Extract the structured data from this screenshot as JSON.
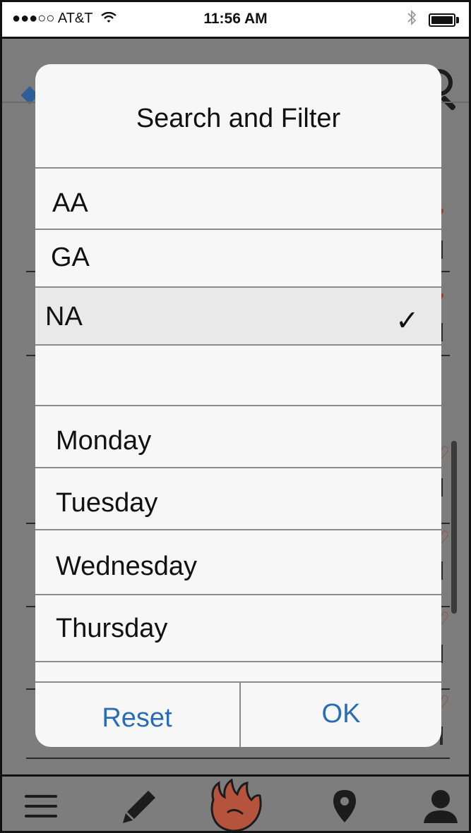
{
  "status_bar": {
    "carrier": "●●●○○ AT&T",
    "time": "11:56 AM"
  },
  "dialog": {
    "title": "Search and Filter",
    "types": [
      {
        "label": "AA",
        "selected": false
      },
      {
        "label": "GA",
        "selected": false
      },
      {
        "label": "NA",
        "selected": true
      }
    ],
    "check_glyph": "✓",
    "days": [
      "Monday",
      "Tuesday",
      "Wednesday",
      "Thursday"
    ],
    "reset_label": "Reset",
    "ok_label": "OK"
  },
  "tab_bar": {
    "items": [
      "menu-icon",
      "pencil-icon",
      "flame-icon",
      "map-pin-icon",
      "user-icon"
    ]
  },
  "colors": {
    "accent": "#2a6db5",
    "overlay": "#7d7d7d",
    "dialog_bg": "#f7f7f7",
    "flame": "#b5533d"
  }
}
